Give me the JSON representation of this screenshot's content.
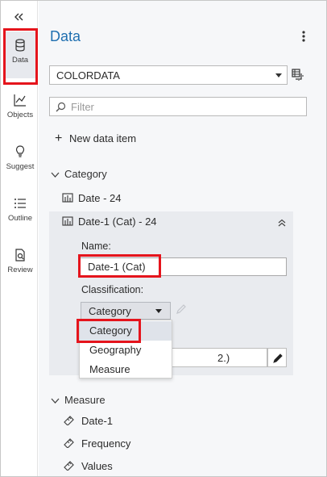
{
  "rail": {
    "items": [
      {
        "label": "Data",
        "icon": "database-icon"
      },
      {
        "label": "Objects",
        "icon": "line-chart-icon"
      },
      {
        "label": "Suggest",
        "icon": "lightbulb-icon"
      },
      {
        "label": "Outline",
        "icon": "list-icon"
      },
      {
        "label": "Review",
        "icon": "review-icon"
      }
    ]
  },
  "header": {
    "title": "Data"
  },
  "data_source": {
    "selected": "COLORDATA"
  },
  "filter": {
    "placeholder": "Filter"
  },
  "new_item": {
    "label": "New data item"
  },
  "category_group": {
    "label": "Category",
    "items": [
      {
        "label": "Date - 24"
      },
      {
        "label": "Date-1 (Cat) - 24"
      }
    ]
  },
  "details": {
    "name_label": "Name:",
    "name_value": "Date-1 (Cat)",
    "classification_label": "Classification:",
    "classification_value": "Category",
    "format_value_visible": "2.)"
  },
  "classification_dropdown": {
    "options": [
      "Category",
      "Geography",
      "Measure"
    ],
    "selected": "Category"
  },
  "measure_group": {
    "label": "Measure",
    "items": [
      {
        "label": "Date-1"
      },
      {
        "label": "Frequency"
      },
      {
        "label": "Values"
      }
    ]
  },
  "colors": {
    "accent": "#1f6fb0",
    "highlight": "#e5141c"
  }
}
